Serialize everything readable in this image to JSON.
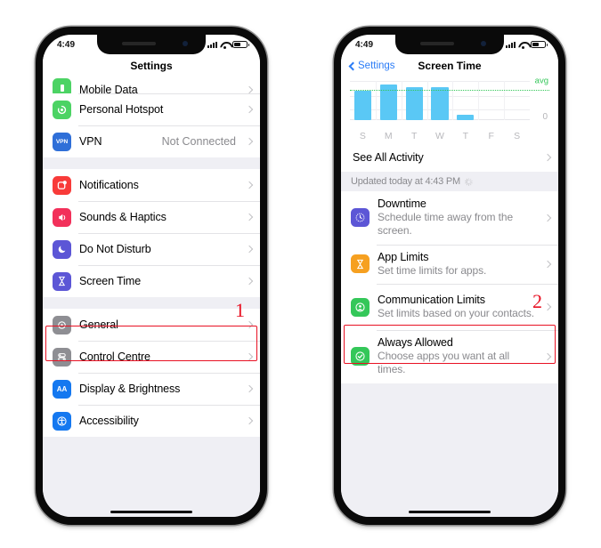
{
  "left_phone": {
    "status_bar": {
      "time": "4:49",
      "signal_icon": "signal-bars-icon",
      "wifi_icon": "wifi-icon",
      "battery_icon": "battery-icon"
    },
    "nav_title": "Settings",
    "groups": [
      {
        "rows": [
          {
            "label": "Mobile Data",
            "value": "",
            "icon": "mobile-data-icon",
            "color": "#4cd364",
            "glyph": "",
            "clipped": true
          },
          {
            "label": "Personal Hotspot",
            "value": "",
            "icon": "personal-hotspot-icon",
            "color": "#4cd364",
            "glyph": "",
            "clipped": false
          },
          {
            "label": "VPN",
            "value": "Not Connected",
            "icon": "vpn-icon",
            "color": "#2f6fd8",
            "glyph": "VPN",
            "clipped": false
          }
        ]
      },
      {
        "rows": [
          {
            "label": "Notifications",
            "value": "",
            "icon": "notifications-icon",
            "color": "#f83b39",
            "glyph": "",
            "clipped": false
          },
          {
            "label": "Sounds & Haptics",
            "value": "",
            "icon": "sounds-haptics-icon",
            "color": "#f2305a",
            "glyph": "",
            "clipped": false
          },
          {
            "label": "Do Not Disturb",
            "value": "",
            "icon": "do-not-disturb-icon",
            "color": "#5c56d6",
            "glyph": "",
            "clipped": false
          },
          {
            "label": "Screen Time",
            "value": "",
            "icon": "screen-time-icon",
            "color": "#5c56d6",
            "glyph": "",
            "clipped": false
          }
        ]
      },
      {
        "rows": [
          {
            "label": "General",
            "value": "",
            "icon": "general-gear-icon",
            "color": "#8e8e93",
            "glyph": "",
            "clipped": false
          },
          {
            "label": "Control Centre",
            "value": "",
            "icon": "control-centre-icon",
            "color": "#8e8e93",
            "glyph": "",
            "clipped": false
          },
          {
            "label": "Display & Brightness",
            "value": "",
            "icon": "display-brightness-icon",
            "color": "#1478f0",
            "glyph": "AA",
            "clipped": false
          },
          {
            "label": "Accessibility",
            "value": "",
            "icon": "accessibility-icon",
            "color": "#1478f0",
            "glyph": "",
            "clipped": false
          }
        ]
      }
    ]
  },
  "right_phone": {
    "status_bar": {
      "time": "4:49",
      "signal_icon": "signal-bars-icon",
      "wifi_icon": "wifi-icon",
      "battery_icon": "battery-icon"
    },
    "nav_back_label": "Settings",
    "nav_title": "Screen Time",
    "see_all_activity": "See All Activity",
    "updated_text": "Updated today at 4:43 PM",
    "feature_rows": [
      {
        "title": "Downtime",
        "subtitle": "Schedule time away from the screen.",
        "icon": "downtime-icon",
        "color": "#5c56d6"
      },
      {
        "title": "App Limits",
        "subtitle": "Set time limits for apps.",
        "icon": "app-limits-hourglass-icon",
        "color": "#f6a020"
      },
      {
        "title": "Communication Limits",
        "subtitle": "Set limits based on your contacts.",
        "icon": "communication-limits-icon",
        "color": "#34c759"
      },
      {
        "title": "Always Allowed",
        "subtitle": "Choose apps you want at all times.",
        "icon": "always-allowed-icon",
        "color": "#34c759"
      }
    ]
  },
  "chart_data": {
    "type": "bar",
    "title": "Screen Time",
    "categories": [
      "S",
      "M",
      "T",
      "W",
      "T",
      "F",
      "S"
    ],
    "values": [
      83,
      100,
      93,
      92,
      14,
      0,
      0
    ],
    "ylim": [
      0,
      110
    ],
    "ylabel": "",
    "xlabel": "",
    "tick_labels": [
      "0"
    ],
    "annotations": [
      {
        "label": "avg",
        "value": 83,
        "style": "dotted-line",
        "color": "#34c759"
      }
    ],
    "bar_color": "#5ac8f5",
    "grid": true,
    "legend": "none"
  },
  "annotations": {
    "step_one": "1",
    "step_two": "2",
    "highlight_color": "#e81123"
  }
}
